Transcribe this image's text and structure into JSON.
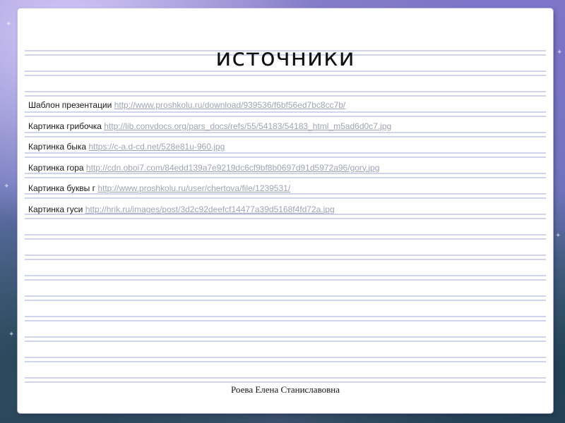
{
  "slide": {
    "title": "источники",
    "sources": [
      {
        "label": "Шаблон презентации",
        "url": "http://www.proshkolu.ru/download/939536/f6bf56ed7bc8cc7b/"
      },
      {
        "label": "Картинка грибочка",
        "url": "http://lib.convdocs.org/pars_docs/refs/55/54183/54183_html_m5ad6d0c7.jpg"
      },
      {
        "label": "Картинка быка",
        "url": "https://c-a.d-cd.net/528e81u-960.jpg"
      },
      {
        "label": "Картинка гора",
        "url": "http://cdn.oboi7.com/84edd139a7e9219dc6cf9bf8b0697d91d5972a96/gory.jpg"
      },
      {
        "label": "Картинка буквы г",
        "url": "http://www.proshkolu.ru/user/chertova/file/1239531/"
      },
      {
        "label": "Картинка гуси",
        "url": "http://hrik.ru/images/post/3d2c92deefcf14477a39d5168f4fd72a.jpg"
      }
    ],
    "footer": "Роева Елена Станиславовна"
  }
}
